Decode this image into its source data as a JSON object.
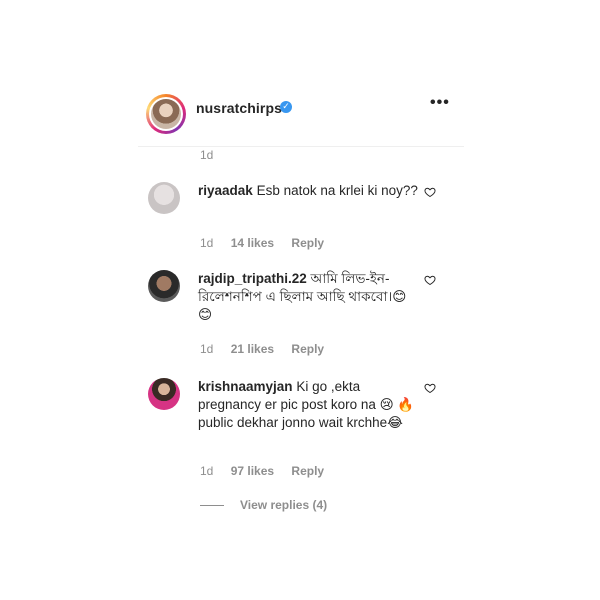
{
  "post": {
    "username": "nusratchirps",
    "verified_icon": "verified-badge-icon",
    "more_label": "•••",
    "time": "1d"
  },
  "comments": [
    {
      "username": "riyaadak",
      "text": "Esb natok na krlei ki noy??",
      "time": "1d",
      "likes": "14 likes",
      "reply": "Reply"
    },
    {
      "username": "rajdip_tripathi.22",
      "text": "আমি লিভ-ইন-রিলেশনশিপ এ ছিলাম আছি থাকবো।😊😊",
      "time": "1d",
      "likes": "21 likes",
      "reply": "Reply"
    },
    {
      "username": "krishnaamyjan",
      "text": "Ki go ,ekta pregnancy er pic post koro na 😢 🔥 public dekhar jonno wait krchhe😂",
      "time": "1d",
      "likes": "97 likes",
      "reply": "Reply"
    }
  ],
  "view_replies": "View replies (4)",
  "icons": {
    "heart": "heart-outline-icon",
    "more": "more-options-icon"
  },
  "colors": {
    "verified": "#3897f0",
    "meta": "#8e8e8e",
    "text": "#262626"
  }
}
